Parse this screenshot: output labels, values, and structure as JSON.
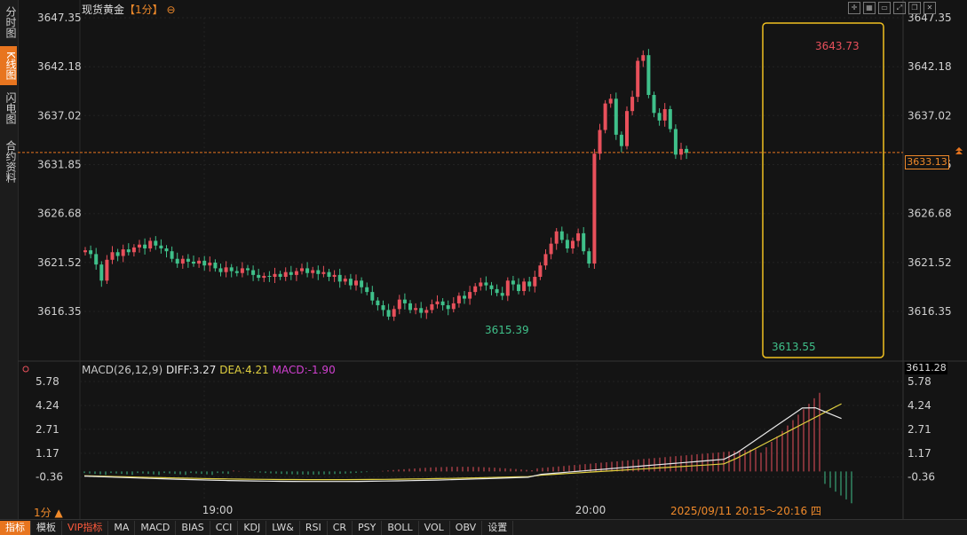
{
  "sidebar": {
    "tabs": [
      {
        "label": "分时图",
        "active": false
      },
      {
        "label": "K线图",
        "active": true
      },
      {
        "label": "闪电图",
        "active": false
      },
      {
        "label": "合约资料",
        "active": false
      }
    ]
  },
  "header": {
    "instrument": "现货黄金",
    "timeframe": "【1分】",
    "settings_glyph": "⊖",
    "toolbar_icons": [
      "crosshair-icon",
      "grid-icon",
      "window-icon",
      "fullscreen-icon",
      "restore-icon",
      "close-icon"
    ]
  },
  "price_axis": {
    "ticks": [
      "3647.35",
      "3642.18",
      "3637.02",
      "3631.85",
      "3626.68",
      "3621.52",
      "3616.35"
    ],
    "current_price": "3633.13",
    "low_marker": "3611.28"
  },
  "annotations": {
    "high_label": "3643.73",
    "low_label_1": "3615.39",
    "low_label_2": "3613.55"
  },
  "macd": {
    "name": "MACD(26,12,9)",
    "diff": "DIFF:3.27",
    "dea": "DEA:4.21",
    "macd": "MACD:-1.90",
    "ticks": [
      "5.78",
      "4.24",
      "2.71",
      "1.17",
      "-0.36"
    ]
  },
  "time_axis": {
    "labels": [
      "19:00",
      "20:00"
    ],
    "interval": "1分 ▲",
    "selected_range": "2025/09/11 20:15～20:16 四"
  },
  "colors": {
    "up": "#e8505b",
    "down": "#3fc08a",
    "accent": "#e8751f",
    "highlight_box": "#f0c020",
    "dea_line": "#e0d040",
    "diff_line": "#e8e8e8"
  },
  "bottom_toolbar": [
    {
      "label": "指标",
      "active": true,
      "vip": false
    },
    {
      "label": "模板",
      "active": false,
      "vip": false
    },
    {
      "label": "VIP指标",
      "active": false,
      "vip": true
    },
    {
      "label": "MA",
      "active": false,
      "vip": false
    },
    {
      "label": "MACD",
      "active": false,
      "vip": false
    },
    {
      "label": "BIAS",
      "active": false,
      "vip": false
    },
    {
      "label": "CCI",
      "active": false,
      "vip": false
    },
    {
      "label": "KDJ",
      "active": false,
      "vip": false
    },
    {
      "label": "LW&",
      "active": false,
      "vip": false
    },
    {
      "label": "RSI",
      "active": false,
      "vip": false
    },
    {
      "label": "CR",
      "active": false,
      "vip": false
    },
    {
      "label": "PSY",
      "active": false,
      "vip": false
    },
    {
      "label": "BOLL",
      "active": false,
      "vip": false
    },
    {
      "label": "VOL",
      "active": false,
      "vip": false
    },
    {
      "label": "OBV",
      "active": false,
      "vip": false
    },
    {
      "label": "设置",
      "active": false,
      "vip": false
    }
  ],
  "chart_data": {
    "type": "candlestick",
    "interval": "1分",
    "y_ticks": [
      3647.35,
      3642.18,
      3637.02,
      3631.85,
      3626.68,
      3621.52,
      3616.35
    ],
    "current_price": 3633.13,
    "high": 3643.73,
    "lows": [
      3615.39,
      3613.55
    ],
    "x_labels": [
      "19:00",
      "20:00"
    ],
    "macd": {
      "diff": 3.27,
      "dea": 4.21,
      "macd": -1.9,
      "ticks": [
        5.78,
        4.24,
        2.71,
        1.17,
        -0.36
      ]
    }
  }
}
